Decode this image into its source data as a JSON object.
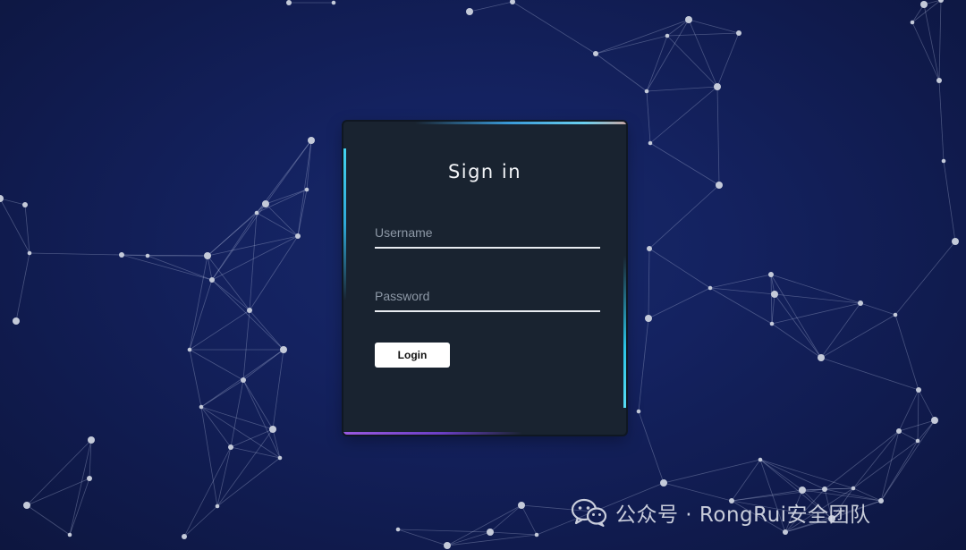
{
  "form": {
    "title": "Sign in",
    "username_placeholder": "Username",
    "username_value": "",
    "password_placeholder": "Password",
    "password_value": "",
    "login_label": "Login"
  },
  "watermark": {
    "icon": "wechat-icon",
    "text": "公众号 · RongRui安全团队"
  },
  "colors": {
    "background": "#142260",
    "panel": "#192330",
    "accent_cyan": "#44d4f0",
    "accent_purple": "#9a5ae0",
    "button": "#ffffff"
  }
}
